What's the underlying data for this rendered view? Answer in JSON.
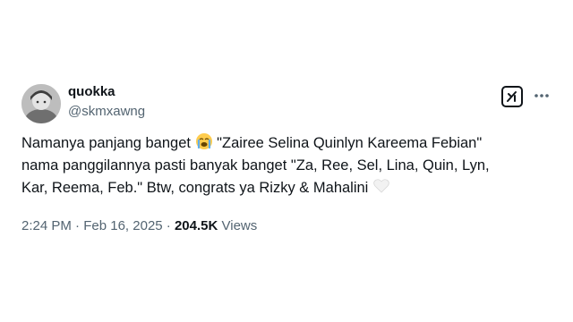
{
  "tweet": {
    "author_name": "quokka",
    "author_handle": "@skmxawng",
    "line1_before_emoji": "Namanya panjang banget",
    "line1_emoji": "loudly-crying-face",
    "line1_after_emoji": "\"Zairee Selina Quinlyn Kareema Febian\"",
    "line2": "nama panggilannya pasti banyak banget \"Za, Ree, Sel, Lina, Quin, Lyn,",
    "line3": "Kar, Reema, Feb.\" Btw, congrats ya Rizky & Mahalini",
    "line3_emoji": "white-heart",
    "time": "2:24 PM",
    "separator": "·",
    "date": "Feb 16, 2025",
    "views_count": "204.5K",
    "views_label": "Views"
  },
  "icons": {
    "grok": "grok-icon",
    "more": "more-icon"
  }
}
